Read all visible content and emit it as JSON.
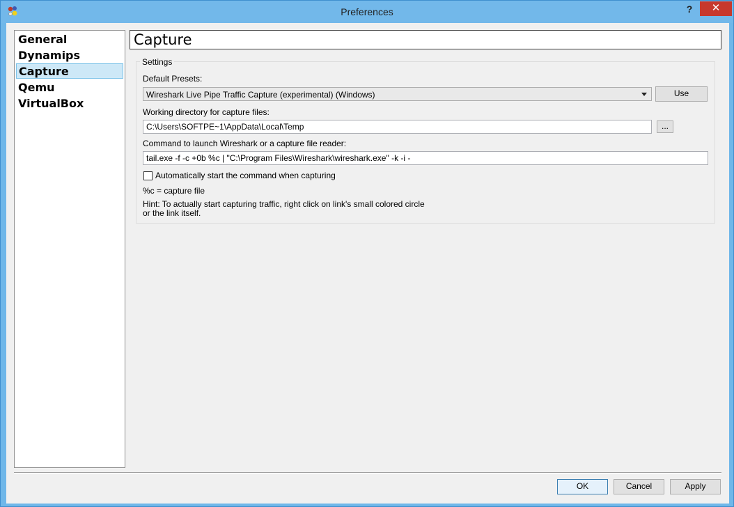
{
  "window": {
    "title": "Preferences",
    "help_label": "?",
    "close_label": "✕"
  },
  "nav": {
    "items": [
      {
        "label": "General"
      },
      {
        "label": "Dynamips"
      },
      {
        "label": "Capture"
      },
      {
        "label": "Qemu"
      },
      {
        "label": "VirtualBox"
      }
    ],
    "selected": "Capture"
  },
  "page": {
    "header": "Capture"
  },
  "settings": {
    "group_title": "Settings",
    "presets_label": "Default Presets:",
    "preset_value": "Wireshark Live Pipe Traffic Capture (experimental) (Windows)",
    "use_label": "Use",
    "workdir_label": "Working directory for capture files:",
    "workdir_value": "C:\\Users\\SOFTPE~1\\AppData\\Local\\Temp",
    "browse_label": "...",
    "command_label": "Command to launch Wireshark or a capture file reader:",
    "command_value": "tail.exe -f -c +0b %c | \"C:\\Program Files\\Wireshark\\wireshark.exe\" -k -i -",
    "autostart_label": "Automatically start the command when capturing",
    "autostart_checked": false,
    "capture_note": "%c = capture file",
    "hint_line1": "Hint: To actually start capturing traffic, right click on link's small colored circle",
    "hint_line2": "or the link itself."
  },
  "footer": {
    "ok_label": "OK",
    "cancel_label": "Cancel",
    "apply_label": "Apply"
  },
  "colors": {
    "titlebar": "#72b8ea",
    "close": "#c7382d",
    "selection": "#cde8f7"
  }
}
